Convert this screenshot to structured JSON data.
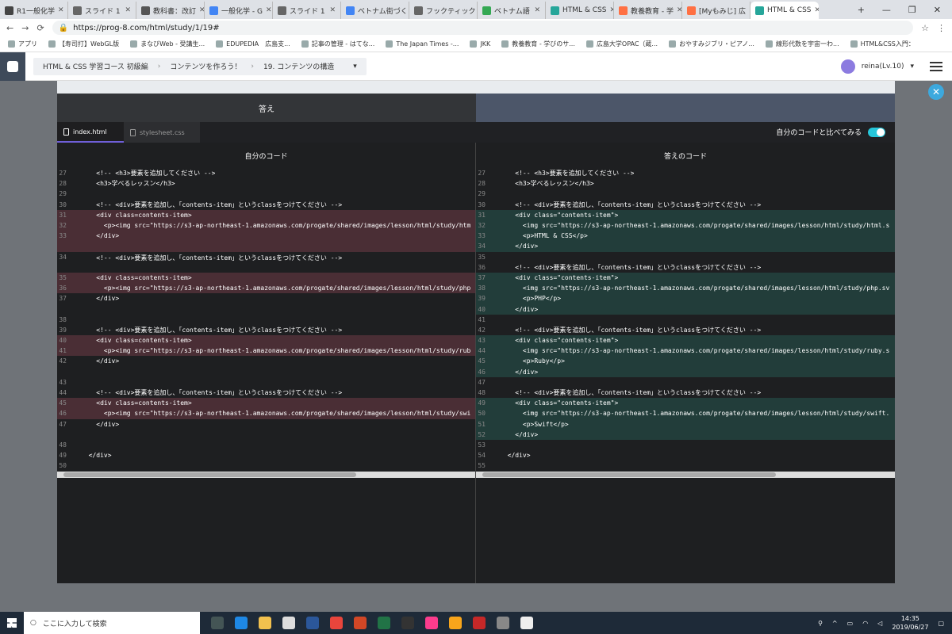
{
  "browser": {
    "tabs": [
      {
        "label": "R1一般化学",
        "color": "#444"
      },
      {
        "label": "スライド 1",
        "color": "#666"
      },
      {
        "label": "教科書：改訂",
        "color": "#555"
      },
      {
        "label": "一般化学 - G",
        "color": "#4285f4"
      },
      {
        "label": "スライド 1",
        "color": "#666"
      },
      {
        "label": "ベトナム街づく",
        "color": "#4285f4"
      },
      {
        "label": "フックティック",
        "color": "#666"
      },
      {
        "label": "ベトナム語",
        "color": "#34a853"
      },
      {
        "label": "HTML & CSS",
        "color": "#26a69a"
      },
      {
        "label": "教養教育 - 学",
        "color": "#ff7043"
      },
      {
        "label": "[Myもみじ] 広",
        "color": "#ff7043"
      },
      {
        "label": "HTML & CSS",
        "color": "#26a69a"
      }
    ],
    "url": "https://prog-8.com/html/study/1/19#",
    "bookmarks": [
      "アプリ",
      "【寿司打】WebGL版",
      "まなびWeb - 受講生...",
      "EDUPEDIA　広島支...",
      "記事の管理 - はてな...",
      "The Japan Times -...",
      "JKK",
      "教養教育 - 学びのサ...",
      "広島大学OPAC（蔵...",
      "おやすみジブリ・ピアノ...",
      "線形代数を宇宙一わ...",
      "HTML&CSS入門："
    ]
  },
  "header": {
    "crumbs": [
      "HTML & CSS 学習コース 初級編",
      "コンテンツを作ろう！",
      "19. コンテンツの構造"
    ],
    "user": "reina(Lv.10)"
  },
  "modal": {
    "tab_answer": "答え",
    "file_tabs": [
      "index.html",
      "stylesheet.css"
    ],
    "compare_label": "自分のコードと比べてみる",
    "left_title": "自分のコード",
    "right_title": "答えのコード"
  },
  "left_code": [
    {
      "n": "27",
      "t": "    <!-- <h3>要素を追加してください -->",
      "h": false
    },
    {
      "n": "28",
      "t": "    <h3>学べるレッスン</h3>",
      "h": false
    },
    {
      "n": "29",
      "t": "",
      "h": false
    },
    {
      "n": "30",
      "t": "    <!-- <div>要素を追加し、「contents-item」というclassをつけてください -->",
      "h": false
    },
    {
      "n": "31",
      "t": "    <div class=contents-item>",
      "h": true
    },
    {
      "n": "32",
      "t": "      <p><img src=\"https://s3-ap-northeast-1.amazonaws.com/progate/shared/images/lesson/html/study/htm",
      "h": true
    },
    {
      "n": "33",
      "t": "    </div>",
      "h": true,
      "gap": true
    },
    {
      "n": "34",
      "t": "    <!-- <div>要素を追加し、「contents-item」というclassをつけてください -->",
      "h": false,
      "gap": true
    },
    {
      "n": "35",
      "t": "    <div class=contents-item>",
      "h": true
    },
    {
      "n": "36",
      "t": "      <p><img src=\"https://s3-ap-northeast-1.amazonaws.com/progate/shared/images/lesson/html/study/php",
      "h": true
    },
    {
      "n": "37",
      "t": "    </div>",
      "h": false,
      "gap": true
    },
    {
      "n": "38",
      "t": "",
      "h": false
    },
    {
      "n": "39",
      "t": "    <!-- <div>要素を追加し、「contents-item」というclassをつけてください -->",
      "h": false
    },
    {
      "n": "40",
      "t": "    <div class=contents-item>",
      "h": true
    },
    {
      "n": "41",
      "t": "      <p><img src=\"https://s3-ap-northeast-1.amazonaws.com/progate/shared/images/lesson/html/study/rub",
      "h": true
    },
    {
      "n": "42",
      "t": "    </div>",
      "h": false,
      "gap": true
    },
    {
      "n": "43",
      "t": "",
      "h": false
    },
    {
      "n": "44",
      "t": "    <!-- <div>要素を追加し、「contents-item」というclassをつけてください -->",
      "h": false
    },
    {
      "n": "45",
      "t": "    <div class=contents-item>",
      "h": true
    },
    {
      "n": "46",
      "t": "      <p><img src=\"https://s3-ap-northeast-1.amazonaws.com/progate/shared/images/lesson/html/study/swi",
      "h": true
    },
    {
      "n": "47",
      "t": "    </div>",
      "h": false,
      "gap": true
    },
    {
      "n": "48",
      "t": "",
      "h": false
    },
    {
      "n": "49",
      "t": "  </div>",
      "h": false
    },
    {
      "n": "50",
      "t": "",
      "h": false
    }
  ],
  "right_code": [
    {
      "n": "27",
      "t": "    <!-- <h3>要素を追加してください -->",
      "h": false
    },
    {
      "n": "28",
      "t": "    <h3>学べるレッスン</h3>",
      "h": false
    },
    {
      "n": "29",
      "t": "",
      "h": false
    },
    {
      "n": "30",
      "t": "    <!-- <div>要素を追加し、「contents-item」というclassをつけてください -->",
      "h": false
    },
    {
      "n": "31",
      "t": "    <div class=\"contents-item\">",
      "h": true
    },
    {
      "n": "32",
      "t": "      <img src=\"https://s3-ap-northeast-1.amazonaws.com/progate/shared/images/lesson/html/study/html.s",
      "h": true
    },
    {
      "n": "33",
      "t": "      <p>HTML & CSS</p>",
      "h": true
    },
    {
      "n": "34",
      "t": "    </div>",
      "h": true
    },
    {
      "n": "35",
      "t": "",
      "h": false
    },
    {
      "n": "36",
      "t": "    <!-- <div>要素を追加し、「contents-item」というclassをつけてください -->",
      "h": false
    },
    {
      "n": "37",
      "t": "    <div class=\"contents-item\">",
      "h": true
    },
    {
      "n": "38",
      "t": "      <img src=\"https://s3-ap-northeast-1.amazonaws.com/progate/shared/images/lesson/html/study/php.sv",
      "h": true
    },
    {
      "n": "39",
      "t": "      <p>PHP</p>",
      "h": true
    },
    {
      "n": "40",
      "t": "    </div>",
      "h": true
    },
    {
      "n": "41",
      "t": "",
      "h": false
    },
    {
      "n": "42",
      "t": "    <!-- <div>要素を追加し、「contents-item」というclassをつけてください -->",
      "h": false
    },
    {
      "n": "43",
      "t": "    <div class=\"contents-item\">",
      "h": true
    },
    {
      "n": "44",
      "t": "      <img src=\"https://s3-ap-northeast-1.amazonaws.com/progate/shared/images/lesson/html/study/ruby.s",
      "h": true
    },
    {
      "n": "45",
      "t": "      <p>Ruby</p>",
      "h": true
    },
    {
      "n": "46",
      "t": "    </div>",
      "h": true
    },
    {
      "n": "47",
      "t": "",
      "h": false
    },
    {
      "n": "48",
      "t": "    <!-- <div>要素を追加し、「contents-item」というclassをつけてください -->",
      "h": false
    },
    {
      "n": "49",
      "t": "    <div class=\"contents-item\">",
      "h": true
    },
    {
      "n": "50",
      "t": "      <img src=\"https://s3-ap-northeast-1.amazonaws.com/progate/shared/images/lesson/html/study/swift.",
      "h": true
    },
    {
      "n": "51",
      "t": "      <p>Swift</p>",
      "h": true
    },
    {
      "n": "52",
      "t": "    </div>",
      "h": true
    },
    {
      "n": "53",
      "t": "",
      "h": false
    },
    {
      "n": "54",
      "t": "  </div>",
      "h": false
    },
    {
      "n": "55",
      "t": "",
      "h": false
    }
  ],
  "taskbar": {
    "search_placeholder": "ここに入力して検索",
    "time": "14:35",
    "date": "2019/06/27"
  }
}
